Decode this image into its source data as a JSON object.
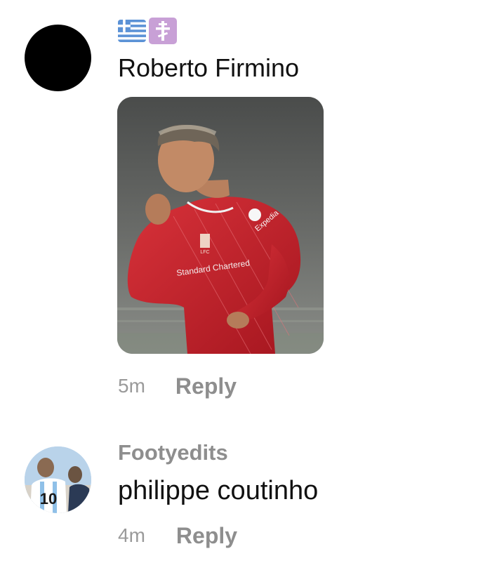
{
  "comments": [
    {
      "avatar": "black-circle-avatar",
      "badges": [
        "greece-flag-emoji",
        "orthodox-cross-emoji"
      ],
      "text": "Roberto Firmino",
      "image": {
        "subject": "footballer-photo",
        "sponsor_text": "Standard Chartered",
        "club_badge": "LFC",
        "sleeve_sponsor": "Expedia"
      },
      "time": "5m",
      "reply_label": "Reply"
    },
    {
      "avatar": "footballer-avatar",
      "username": "Footyedits",
      "text": "philippe coutinho",
      "time": "4m",
      "reply_label": "Reply"
    }
  ],
  "colors": {
    "text": "#111111",
    "muted": "#8e8e8e",
    "jersey": "#c8252d",
    "background": "#ffffff"
  }
}
